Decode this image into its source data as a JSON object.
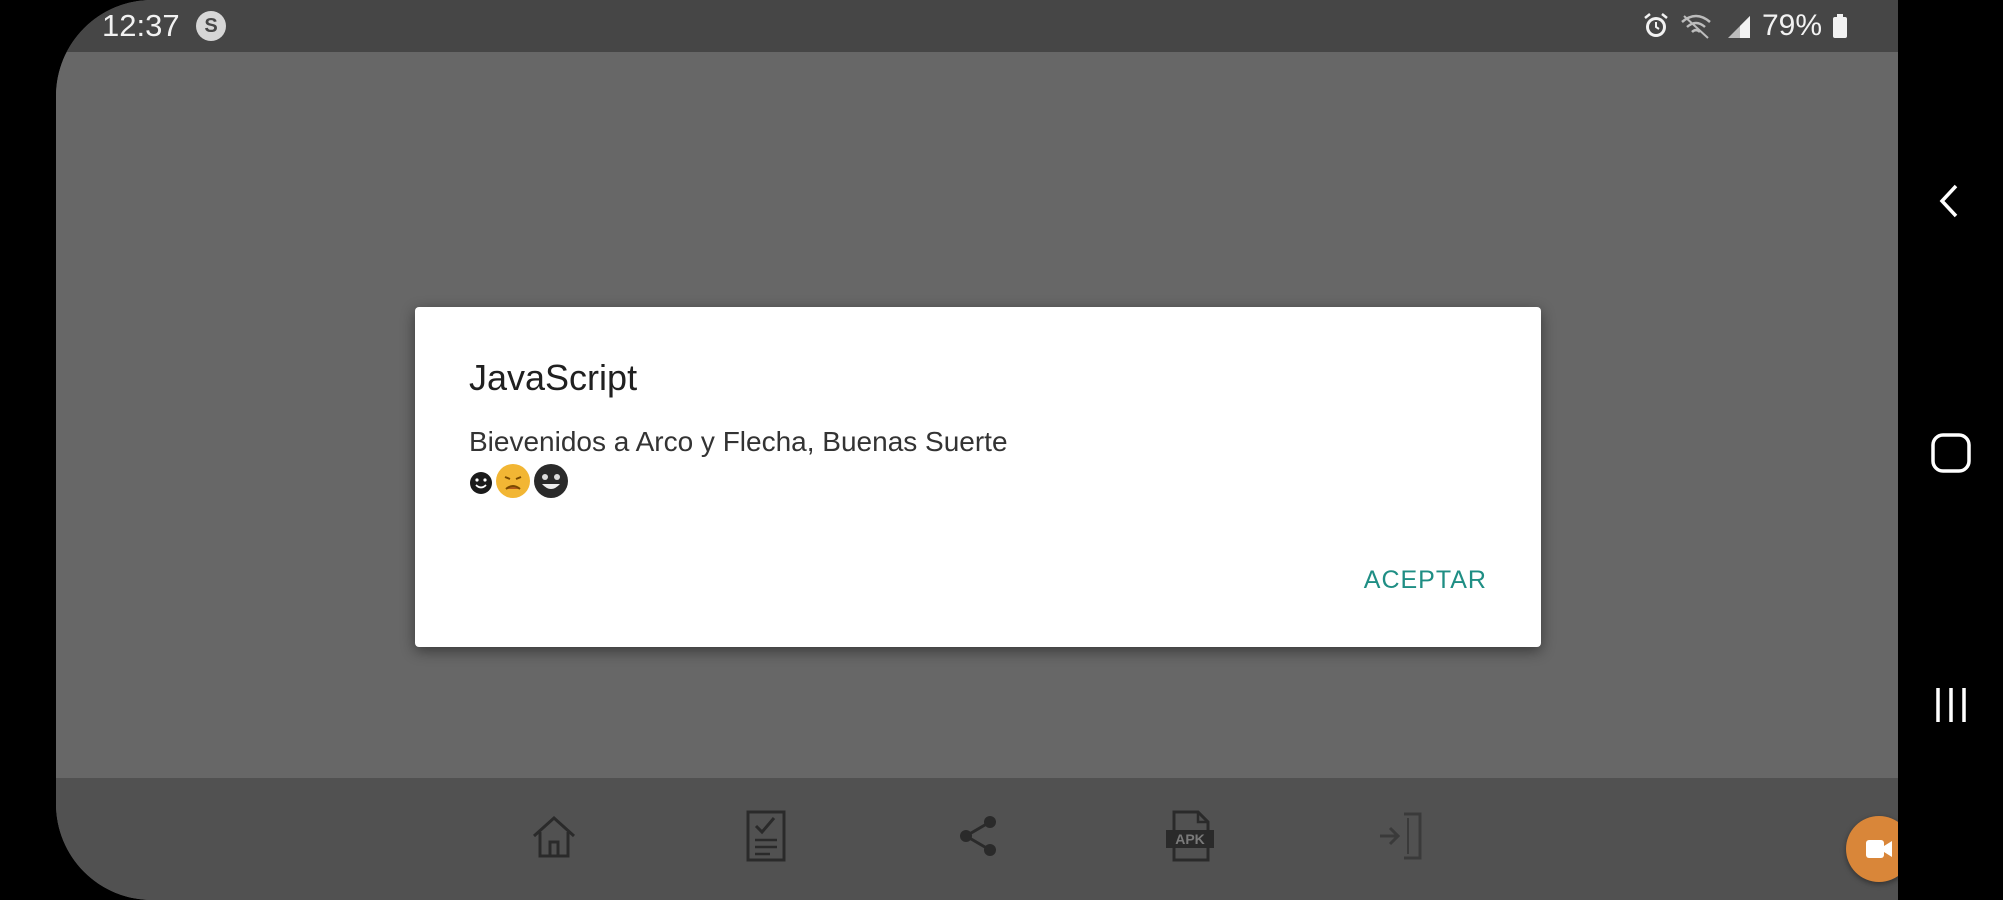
{
  "status_bar": {
    "time": "12:37",
    "notification_letter": "S",
    "battery_percent": "79%"
  },
  "dialog": {
    "title": "JavaScript",
    "message": "Bievenidos a Arco y Flecha, Buenas Suerte",
    "accept_label": "ACEPTAR"
  },
  "bottom_tabs": [
    {
      "icon": "home-icon"
    },
    {
      "icon": "clipboard-check-icon"
    },
    {
      "icon": "share-icon"
    },
    {
      "icon": "apk-file-icon"
    },
    {
      "icon": "exit-door-icon"
    }
  ],
  "colors": {
    "accent": "#1f8e84",
    "fab": "#d98639",
    "scrim": "#676767",
    "status_bar": "#464646",
    "bottom_bar": "#515151"
  }
}
